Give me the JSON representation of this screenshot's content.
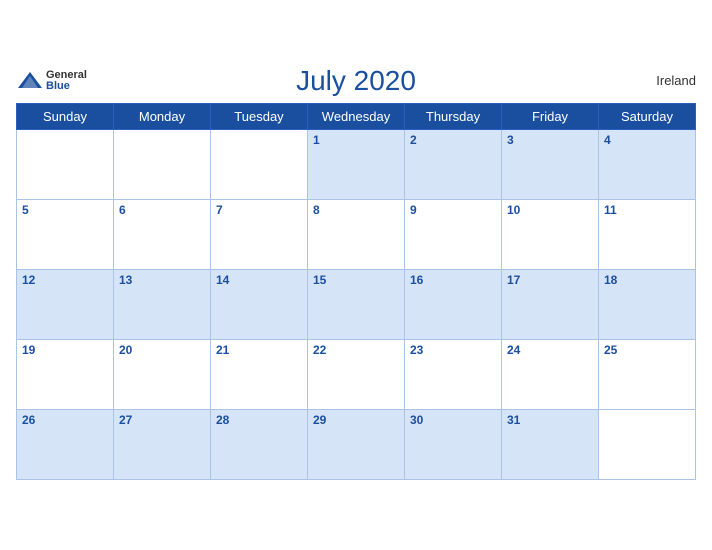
{
  "calendar": {
    "title": "July 2020",
    "country": "Ireland",
    "logo": {
      "general": "General",
      "blue": "Blue"
    },
    "weekdays": [
      "Sunday",
      "Monday",
      "Tuesday",
      "Wednesday",
      "Thursday",
      "Friday",
      "Saturday"
    ],
    "weeks": [
      [
        null,
        null,
        null,
        1,
        2,
        3,
        4
      ],
      [
        5,
        6,
        7,
        8,
        9,
        10,
        11
      ],
      [
        12,
        13,
        14,
        15,
        16,
        17,
        18
      ],
      [
        19,
        20,
        21,
        22,
        23,
        24,
        25
      ],
      [
        26,
        27,
        28,
        29,
        30,
        31,
        null
      ]
    ]
  }
}
